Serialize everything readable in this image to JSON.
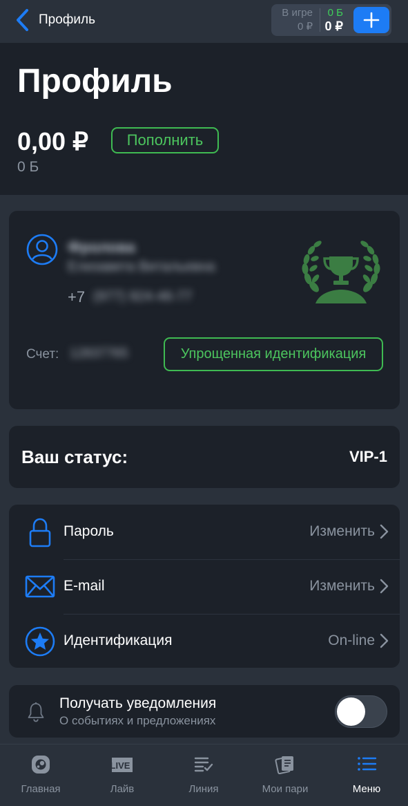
{
  "topbar": {
    "back_label": "Профиль",
    "in_game_label": "В игре",
    "in_game_value": "0 ₽",
    "points_value": "0 Б",
    "balance_value": "0 ₽"
  },
  "header": {
    "title": "Профиль",
    "amount": "0,00 ₽",
    "points": "0 Б",
    "topup_label": "Пополнить"
  },
  "user": {
    "surname": "Фролова",
    "name": "Елизавета Витальевна",
    "phone_prefix": "+7",
    "phone_rest": "(977) 924-46-77",
    "account_label": "Счет:",
    "account_value": "12837765",
    "ident_button": "Упрощенная идентификация"
  },
  "status": {
    "label": "Ваш статус:",
    "value": "VIP-1"
  },
  "settings": [
    {
      "label": "Пароль",
      "value": "Изменить",
      "icon": "lock-icon"
    },
    {
      "label": "E-mail",
      "value": "Изменить",
      "icon": "envelope-icon"
    },
    {
      "label": "Идентификация",
      "value": "On-line",
      "icon": "star-badge-icon"
    }
  ],
  "notifications": {
    "title": "Получать уведомления",
    "subtitle": "О событиях и предложениях",
    "enabled": false
  },
  "tabs": [
    {
      "label": "Главная",
      "icon": "home-ball-icon"
    },
    {
      "label": "Лайв",
      "icon": "live-icon"
    },
    {
      "label": "Линия",
      "icon": "line-list-icon"
    },
    {
      "label": "Мои пари",
      "icon": "coupons-icon"
    },
    {
      "label": "Меню",
      "icon": "menu-list-icon",
      "active": true
    }
  ],
  "colors": {
    "accent_blue": "#1d7cf5",
    "accent_green": "#3fbb52",
    "background": "#2a313b",
    "card": "#1c2129"
  }
}
